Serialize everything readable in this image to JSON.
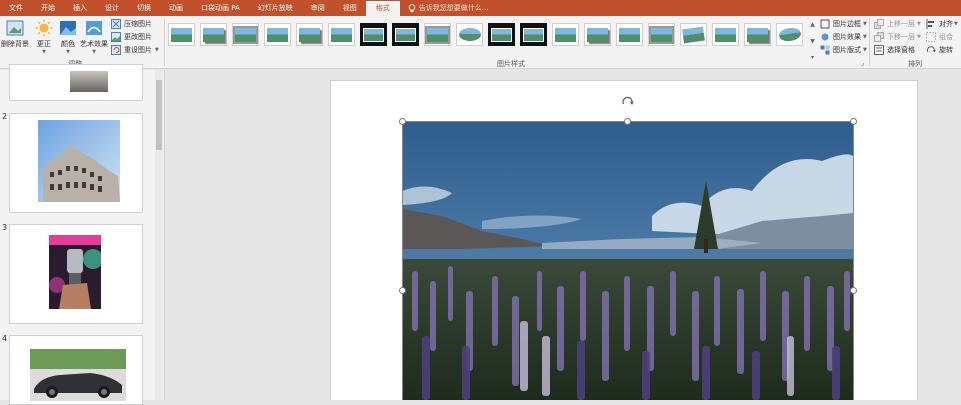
{
  "tabs": [
    {
      "label": "文件"
    },
    {
      "label": "开始"
    },
    {
      "label": "插入"
    },
    {
      "label": "设计"
    },
    {
      "label": "切换"
    },
    {
      "label": "动画"
    },
    {
      "label": "口袋动画 PA"
    },
    {
      "label": "幻灯片放映"
    },
    {
      "label": "审阅"
    },
    {
      "label": "视图"
    },
    {
      "label": "格式",
      "active": true
    }
  ],
  "tellme": {
    "placeholder": "告诉我您想要做什么..."
  },
  "ribbon": {
    "adjust": {
      "remove_bg": "删除背景",
      "correct": "更正",
      "color": "颜色",
      "artistic": "艺术效果",
      "compress": "压缩图片",
      "change": "更改图片",
      "reset": "重设图片",
      "group_label": "调整"
    },
    "picture_styles": {
      "group_label": "图片样式",
      "border": "图片边框",
      "effects": "图片效果",
      "layout": "图片版式"
    },
    "arrange": {
      "group_label": "排列",
      "bring_forward": "上移一层",
      "send_backward": "下移一层",
      "selection_pane": "选择窗格",
      "align": "对齐",
      "group": "组合",
      "rotate": "旋转"
    }
  },
  "slides": [
    {
      "number": "2"
    },
    {
      "number": "3"
    },
    {
      "number": "4"
    }
  ],
  "colors": {
    "accent": "#c1502c",
    "ribbon_bg": "#f3f3f3",
    "canvas_bg": "#e6e6e6"
  }
}
